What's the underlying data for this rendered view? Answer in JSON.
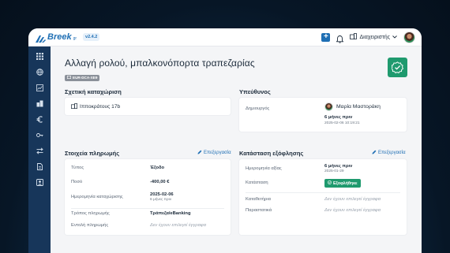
{
  "app": {
    "logo_text": "Breek",
    "logo_sup": "gr",
    "version": "v2.4.2"
  },
  "topbar": {
    "admin_label": "Διαχειριστής"
  },
  "sidebar": {
    "icons": [
      "grid-icon",
      "globe-icon",
      "chart-icon",
      "buildings-icon",
      "euro-icon",
      "key-icon",
      "transfer-icon",
      "document-icon",
      "contacts-icon"
    ]
  },
  "page": {
    "title": "Αλλαγή ρολού, μπαλκονόπορτα τραπεζαρίας",
    "code": "EUR-DCA-XE9"
  },
  "property": {
    "heading": "Σχετική καταχώριση",
    "address": "Ιπποκράτους 17b"
  },
  "responsible": {
    "heading": "Υπεύθυνος",
    "creator_label": "Δημιουργός",
    "creator_name": "Μαρία Μαστοράκη",
    "created_ago": "6 μήνες πριν",
    "created_at": "2025-02-06 10:19:21"
  },
  "payment": {
    "heading": "Στοιχεία πληρωμής",
    "edit_label": "Επεξεργασία",
    "type_label": "Τύπος",
    "type_value": "Έξοδο",
    "amount_label": "Ποσό",
    "amount_value": "-400,00 €",
    "reg_date_label": "Ημερομηνία καταχώρισης",
    "reg_date_value": "2025-02-06",
    "reg_date_ago": "6 μήνες πριν",
    "method_label": "Τρόπος πληρωμής",
    "method_value": "Τράπεζα/eBanking",
    "order_label": "Εντολή πληρωμής",
    "order_value": "Δεν έχουν επιλεγεί έγγραφα"
  },
  "settlement": {
    "heading": "Κατάσταση εξόφλησης",
    "edit_label": "Επεξεργασία",
    "value_date_label": "Ημερομηνία αξίας",
    "value_date_ago": "6 μήνες πριν",
    "value_date": "2025-01-29",
    "status_label": "Κατάσταση",
    "status_value": "Εξοφλήθηκε",
    "receipts_label": "Καταθετήρια",
    "receipts_value": "Δεν έχουν επιλεγεί έγγραφα",
    "docs_label": "Παραστατικά",
    "docs_value": "Δεν έχουν επιλεγεί έγγραφα"
  },
  "colors": {
    "brand": "#1f6fb4",
    "sidebar": "#17365a",
    "success": "#1f9a6e"
  }
}
